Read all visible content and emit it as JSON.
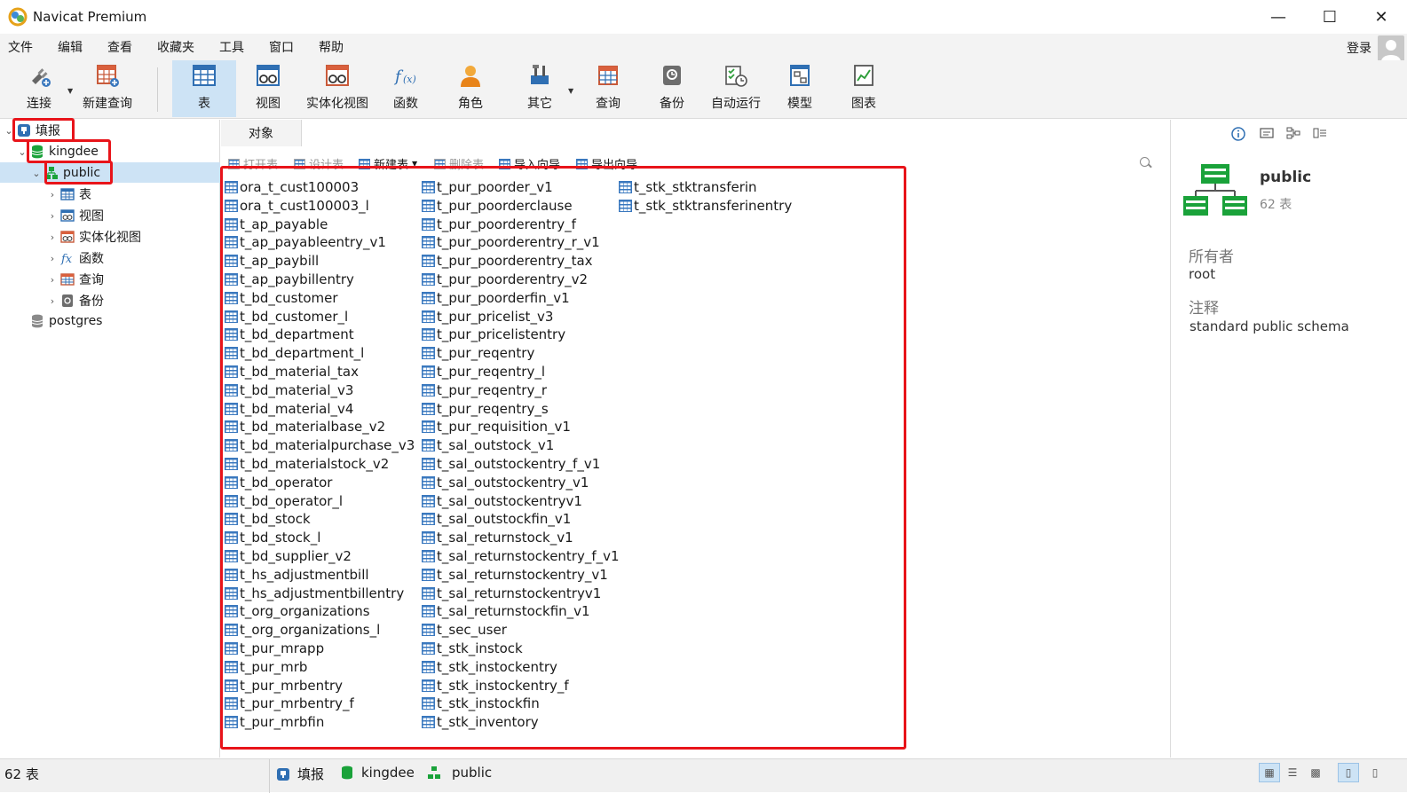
{
  "window": {
    "title": "Navicat Premium"
  },
  "menu": [
    "文件",
    "编辑",
    "查看",
    "收藏夹",
    "工具",
    "窗口",
    "帮助"
  ],
  "login": "登录",
  "toolbar": [
    {
      "label": "连接",
      "icon": "plug-icon"
    },
    {
      "label": "新建查询",
      "icon": "new-query-icon"
    },
    {
      "label": "表",
      "icon": "table-icon"
    },
    {
      "label": "视图",
      "icon": "view-icon"
    },
    {
      "label": "实体化视图",
      "icon": "materialized-view-icon"
    },
    {
      "label": "函数",
      "icon": "function-icon"
    },
    {
      "label": "角色",
      "icon": "role-icon"
    },
    {
      "label": "其它",
      "icon": "tools-icon"
    },
    {
      "label": "查询",
      "icon": "query-icon"
    },
    {
      "label": "备份",
      "icon": "backup-icon"
    },
    {
      "label": "自动运行",
      "icon": "automation-icon"
    },
    {
      "label": "模型",
      "icon": "model-icon"
    },
    {
      "label": "图表",
      "icon": "chart-icon"
    }
  ],
  "tree": {
    "connection": "填报",
    "database": "kingdee",
    "schema": "public",
    "children": [
      "表",
      "视图",
      "实体化视图",
      "函数",
      "查询",
      "备份"
    ],
    "other_database": "postgres"
  },
  "tab_label": "对象",
  "object_toolbar": {
    "open": "打开表",
    "design": "设计表",
    "new": "新建表",
    "delete": "删除表",
    "import": "导入向导",
    "export": "导出向导"
  },
  "tables": {
    "col1": [
      "ora_t_cust100003",
      "ora_t_cust100003_l",
      "t_ap_payable",
      "t_ap_payableentry_v1",
      "t_ap_paybill",
      "t_ap_paybillentry",
      "t_bd_customer",
      "t_bd_customer_l",
      "t_bd_department",
      "t_bd_department_l",
      "t_bd_material_tax",
      "t_bd_material_v3",
      "t_bd_material_v4",
      "t_bd_materialbase_v2",
      "t_bd_materialpurchase_v3",
      "t_bd_materialstock_v2",
      "t_bd_operator",
      "t_bd_operator_l",
      "t_bd_stock",
      "t_bd_stock_l",
      "t_bd_supplier_v2",
      "t_hs_adjustmentbill",
      "t_hs_adjustmentbillentry",
      "t_org_organizations",
      "t_org_organizations_l",
      "t_pur_mrapp",
      "t_pur_mrb",
      "t_pur_mrbentry",
      "t_pur_mrbentry_f",
      "t_pur_mrbfin"
    ],
    "col2": [
      "t_pur_poorder_v1",
      "t_pur_poorderclause",
      "t_pur_poorderentry_f",
      "t_pur_poorderentry_r_v1",
      "t_pur_poorderentry_tax",
      "t_pur_poorderentry_v2",
      "t_pur_poorderfin_v1",
      "t_pur_pricelist_v3",
      "t_pur_pricelistentry",
      "t_pur_reqentry",
      "t_pur_reqentry_l",
      "t_pur_reqentry_r",
      "t_pur_reqentry_s",
      "t_pur_requisition_v1",
      "t_sal_outstock_v1",
      "t_sal_outstockentry_f_v1",
      "t_sal_outstockentry_v1",
      "t_sal_outstockentryv1",
      "t_sal_outstockfin_v1",
      "t_sal_returnstock_v1",
      "t_sal_returnstockentry_f_v1",
      "t_sal_returnstockentry_v1",
      "t_sal_returnstockentryv1",
      "t_sal_returnstockfin_v1",
      "t_sec_user",
      "t_stk_instock",
      "t_stk_instockentry",
      "t_stk_instockentry_f",
      "t_stk_instockfin",
      "t_stk_inventory"
    ],
    "col3": [
      "t_stk_stktransferin",
      "t_stk_stktransferinentry"
    ]
  },
  "info": {
    "name": "public",
    "count": "62 表",
    "owner_label": "所有者",
    "owner": "root",
    "comment_label": "注释",
    "comment": "standard public schema"
  },
  "status": {
    "count": "62 表",
    "connection": "填报",
    "database": "kingdee",
    "schema": "public"
  },
  "colors": {
    "highlight": "#e8141a",
    "selection": "#cde3f5",
    "db_green": "#1aa23a"
  }
}
